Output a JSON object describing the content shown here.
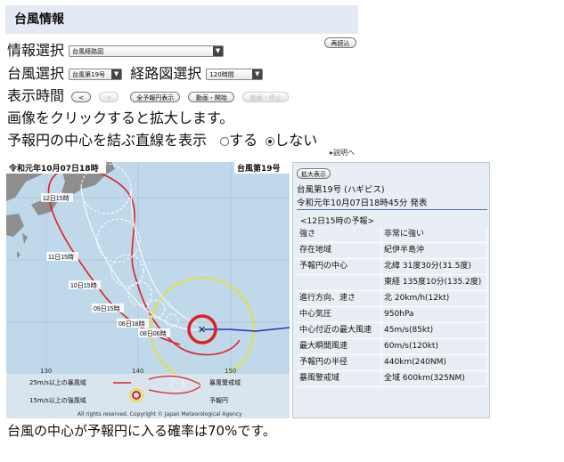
{
  "header": {
    "title": "台風情報"
  },
  "reload_label": "再読込",
  "info_select": {
    "label": "情報選択",
    "value": "台風経路図"
  },
  "typhoon_select": {
    "label": "台風選択",
    "value": "台風第19号"
  },
  "route_select": {
    "label": "経路図選択",
    "value": "120時間"
  },
  "display_time": {
    "label": "表示時間",
    "prev": "<",
    "next": ">",
    "show_all": "全予報円表示",
    "animate": "動画・開始",
    "stop": "動画・停止"
  },
  "zoom_hint": "画像をクリックすると拡大します。",
  "line_option": {
    "label": "予報円の中心を結ぶ直線を表示",
    "on": "する",
    "off": "しない",
    "selected": "off"
  },
  "help_link": "説明へ",
  "map": {
    "timestamp": "令和元年10月07日18時",
    "typhoon_name": "台風第19号",
    "labels": [
      "12日15時",
      "11日15時",
      "10日15時",
      "09日15時",
      "08日18時",
      "08日06時"
    ],
    "lon_ticks": [
      "130",
      "140",
      "150"
    ],
    "legend": {
      "storm_area": "25m/s以上の暴風域",
      "gale_area": "15m/s以上の強風域",
      "storm_warning": "暴風警戒域",
      "forecast_circle": "予報円"
    },
    "copyright": "All rights reserved. Copyright © Japan Meteorological Agency"
  },
  "panel": {
    "enlarge_label": "拡大表示",
    "typhoon_title": "台風第19号 (ハギビス)",
    "issued": "令和元年10月07日18時45分 発表",
    "forecast_header": "<12日15時の予報>",
    "rows": [
      {
        "key": "強さ",
        "value": "非常に強い"
      },
      {
        "key": "存在地域",
        "value": "紀伊半島沖"
      },
      {
        "key": "予報円の中心",
        "value": "北緯 31度30分(31.5度)"
      },
      {
        "key": "",
        "value": "東経 135度10分(135.2度)"
      },
      {
        "key": "進行方向、速さ",
        "value": "北 20km/h(12kt)"
      },
      {
        "key": "中心気圧",
        "value": "950hPa"
      },
      {
        "key": "中心付近の最大風速",
        "value": "45m/s(85kt)"
      },
      {
        "key": "最大瞬間風速",
        "value": "60m/s(120kt)"
      },
      {
        "key": "予報円の半径",
        "value": "440km(240NM)"
      },
      {
        "key": "暴風警戒域",
        "value": "全域 600km(325NM)"
      }
    ]
  },
  "probability_text": "台風の中心が予報円に入る確率は70%です。",
  "colors": {
    "header_bg": "#e4eaf4",
    "sea": "#bfd9ea",
    "land": "#8e8e8e",
    "warning_red": "#e02020",
    "gale_yellow": "#e8e020",
    "panel_bg": "#e9eef4"
  }
}
